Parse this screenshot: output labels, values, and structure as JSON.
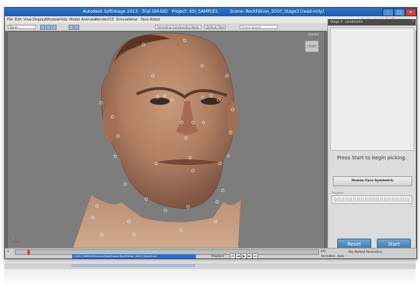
{
  "window": {
    "title_app": "Autodesk Softimage 2013 - Trial (64-bit)",
    "title_project": "Project: XSI_SAMPLES",
    "title_scene": "Scene: RockFalcon_2010_Stage3 [read-only]"
  },
  "menu": {
    "items": [
      "File",
      "Edit",
      "View",
      "Display",
      "Window",
      "Help",
      "Model",
      "Animate",
      "Render",
      "ICE",
      "Simulate",
      "Hair",
      "Face Robot"
    ],
    "brand": "Autodesk Softimage"
  },
  "toolbar": {
    "selection_field": "Bone",
    "mode_field": "Animating Construction Mode",
    "layer_field": "Default_Pass",
    "search_placeholder": "Scene Search"
  },
  "viewport": {
    "label": "Shaded",
    "navcube_label": "FRONT"
  },
  "panel": {
    "stage": "Stage 3",
    "tab": "Landmarks",
    "help": "?",
    "instruction": "Press Start to begin picking.",
    "mode_button": "Human Face Symmetric",
    "progress_label": "Progress",
    "reset_button": "Reset",
    "start_button": "Start"
  },
  "timeline": {
    "start_frame": "1",
    "end_frame": "100",
    "path": "C:\\XSI_SAMPLES\\Scenes\\RockFalcon\\RockFalcon_2010_Stage3.scn",
    "playback_label": "Playback",
    "key_label": "Key Marked Parameters",
    "animation_label": "Animation",
    "auto_label": "Auto"
  },
  "colors": {
    "title_blue": "#2f74c6",
    "button_blue": "#3c74a9",
    "landmark_green": "#d9f2c4"
  }
}
